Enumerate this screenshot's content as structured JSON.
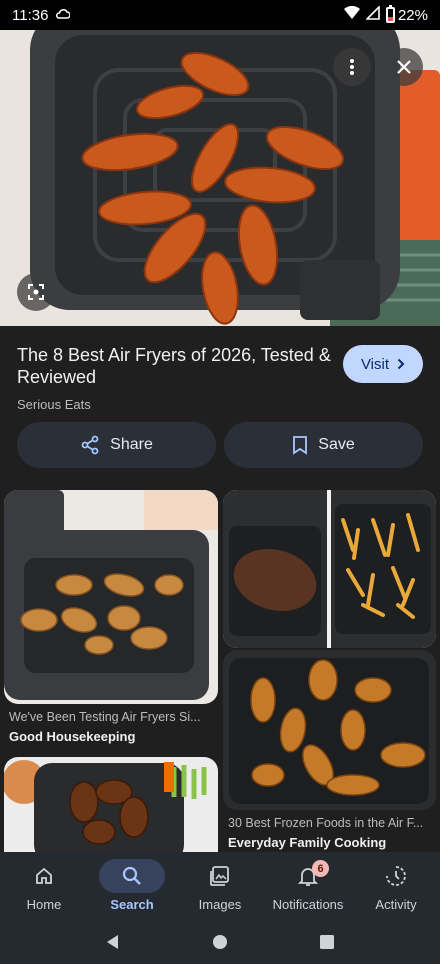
{
  "status_bar": {
    "time": "11:36",
    "battery": "22%"
  },
  "result": {
    "title": "The 8 Best Air Fryers of 2026, Tested & Reviewed",
    "source": "Serious Eats",
    "visit_label": "Visit"
  },
  "actions": {
    "share_label": "Share",
    "save_label": "Save"
  },
  "related": [
    {
      "caption": "We've Been Testing Air Fryers Si...",
      "source": "Good Housekeeping"
    },
    {
      "caption": "30 Best Frozen Foods in the Air F...",
      "source": "Everyday Family Cooking"
    }
  ],
  "bottom_nav": {
    "items": [
      {
        "label": "Home",
        "icon": "home-icon"
      },
      {
        "label": "Search",
        "icon": "search-icon"
      },
      {
        "label": "Images",
        "icon": "images-icon"
      },
      {
        "label": "Notifications",
        "icon": "bell-icon",
        "badge": "6"
      },
      {
        "label": "Activity",
        "icon": "activity-icon"
      }
    ],
    "active": "Search"
  },
  "colors": {
    "accent": "#a8c7ff",
    "visit_bg": "#c2d7ff",
    "pill_bg": "#2b2f37",
    "background": "#1f1f1f"
  }
}
